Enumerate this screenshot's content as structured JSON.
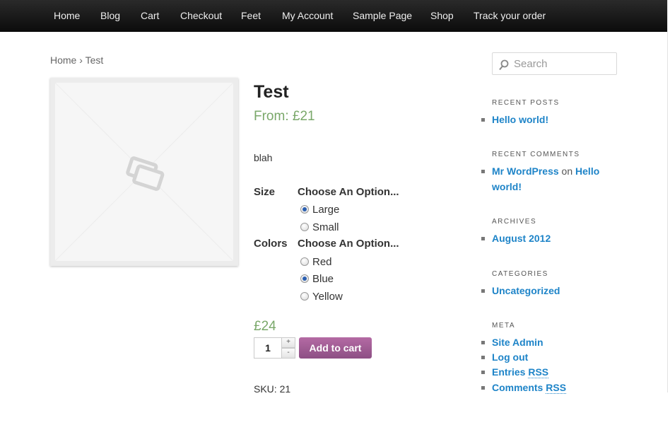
{
  "nav": {
    "items": [
      "Home",
      "Blog",
      "Cart",
      "Checkout",
      "Feet",
      "My Account",
      "Sample Page",
      "Shop",
      "Track your order"
    ]
  },
  "breadcrumb": {
    "home": "Home",
    "separator": " › ",
    "current": "Test"
  },
  "product": {
    "title": "Test",
    "from_price": "From: £21",
    "description": "blah",
    "variations": [
      {
        "label": "Size",
        "choose": "Choose An Option...",
        "options": [
          "Large",
          "Small"
        ],
        "selected": "Large"
      },
      {
        "label": "Colors",
        "choose": "Choose An Option...",
        "options": [
          "Red",
          "Blue",
          "Yellow"
        ],
        "selected": "Blue"
      }
    ],
    "price": "£24",
    "quantity": "1",
    "stepper_up": "+",
    "stepper_down": "-",
    "add_to_cart": "Add to cart",
    "sku": "SKU: 21",
    "image_icon": "image-placeholder-icon"
  },
  "sidebar": {
    "search_placeholder": "Search",
    "recent_posts_title": "Recent Posts",
    "recent_posts": [
      "Hello world!"
    ],
    "recent_comments_title": "Recent Comments",
    "comment_author": "Mr WordPress",
    "comment_on": " on ",
    "comment_post_line1": "Hello",
    "comment_post_line2": "world!",
    "archives_title": "Archives",
    "archives": [
      "August 2012"
    ],
    "categories_title": "Categories",
    "categories": [
      "Uncategorized"
    ],
    "meta_title": "Meta",
    "meta": {
      "site_admin": "Site Admin",
      "log_out": "Log out",
      "entries": "Entries",
      "comments": "Comments",
      "rss": "RSS"
    }
  },
  "colors": {
    "navbar": "#111111",
    "link": "#1e84c8",
    "price": "#7aa86a",
    "add_to_cart": "#a05c96"
  }
}
